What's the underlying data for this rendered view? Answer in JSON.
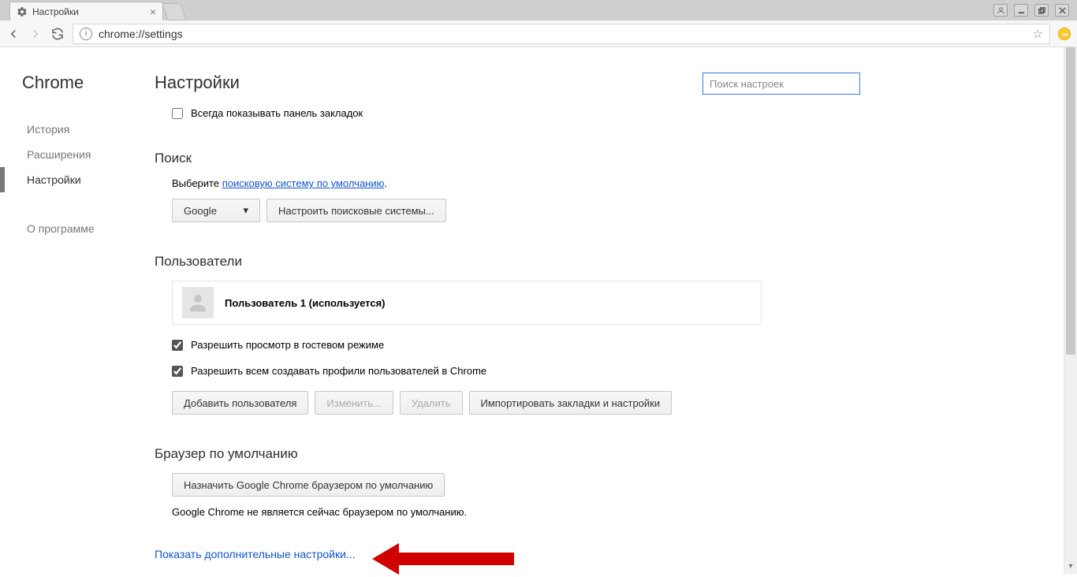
{
  "window": {
    "tab_title": "Настройки"
  },
  "toolbar": {
    "url": "chrome://settings"
  },
  "sidebar": {
    "brand": "Chrome",
    "items": {
      "history": "История",
      "extensions": "Расширения",
      "settings": "Настройки",
      "about": "О программе"
    }
  },
  "header": {
    "title": "Настройки",
    "search_placeholder": "Поиск настроек"
  },
  "bookmarks_bar": {
    "label": "Всегда показывать панель закладок"
  },
  "search": {
    "title": "Поиск",
    "desc_prefix": "Выберите ",
    "desc_link": "поисковую систему по умолчанию",
    "desc_suffix": ".",
    "engine_selected": "Google",
    "manage_btn": "Настроить поисковые системы..."
  },
  "users": {
    "title": "Пользователи",
    "current": "Пользователь 1 (используется)",
    "guest_label": "Разрешить просмотр в гостевом режиме",
    "allow_create_label": "Разрешить всем создавать профили пользователей в Chrome",
    "add_btn": "Добавить пользователя",
    "edit_btn": "Изменить...",
    "delete_btn": "Удалить",
    "import_btn": "Импортировать закладки и настройки"
  },
  "default_browser": {
    "title": "Браузер по умолчанию",
    "set_btn": "Назначить Google Chrome браузером по умолчанию",
    "status": "Google Chrome не является сейчас браузером по умолчанию."
  },
  "show_more": "Показать дополнительные настройки..."
}
